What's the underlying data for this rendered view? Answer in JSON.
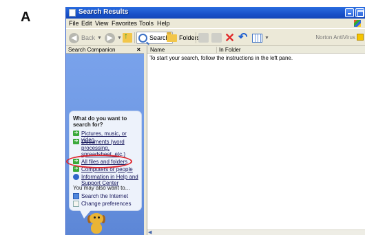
{
  "figure_label": "A",
  "window": {
    "title": "Search Results"
  },
  "menu": [
    "File",
    "Edit",
    "View",
    "Favorites",
    "Tools",
    "Help"
  ],
  "toolbar": {
    "back_label": "Back",
    "search_label": "Search",
    "folders_label": "Folders",
    "addon_label": "Norton AntiVirus"
  },
  "left_pane": {
    "title": "Search Companion",
    "close_glyph": "×",
    "question": "What do you want to search for?",
    "options": [
      "Pictures, music, or video",
      "Documents (word processing, spreadsheet, etc.)",
      "All files and folders",
      "Computers or people",
      "Information in Help and Support Center"
    ],
    "also_label": "You may also want to...",
    "links": [
      "Search the Internet",
      "Change preferences"
    ]
  },
  "results": {
    "columns": [
      "Name",
      "In Folder"
    ],
    "message": "To start your search, follow the instructions in the left pane."
  },
  "accent_colors": {
    "title_bar": "#1851c9",
    "task_pane": "#6d97e2",
    "highlight": "#e0262d"
  }
}
